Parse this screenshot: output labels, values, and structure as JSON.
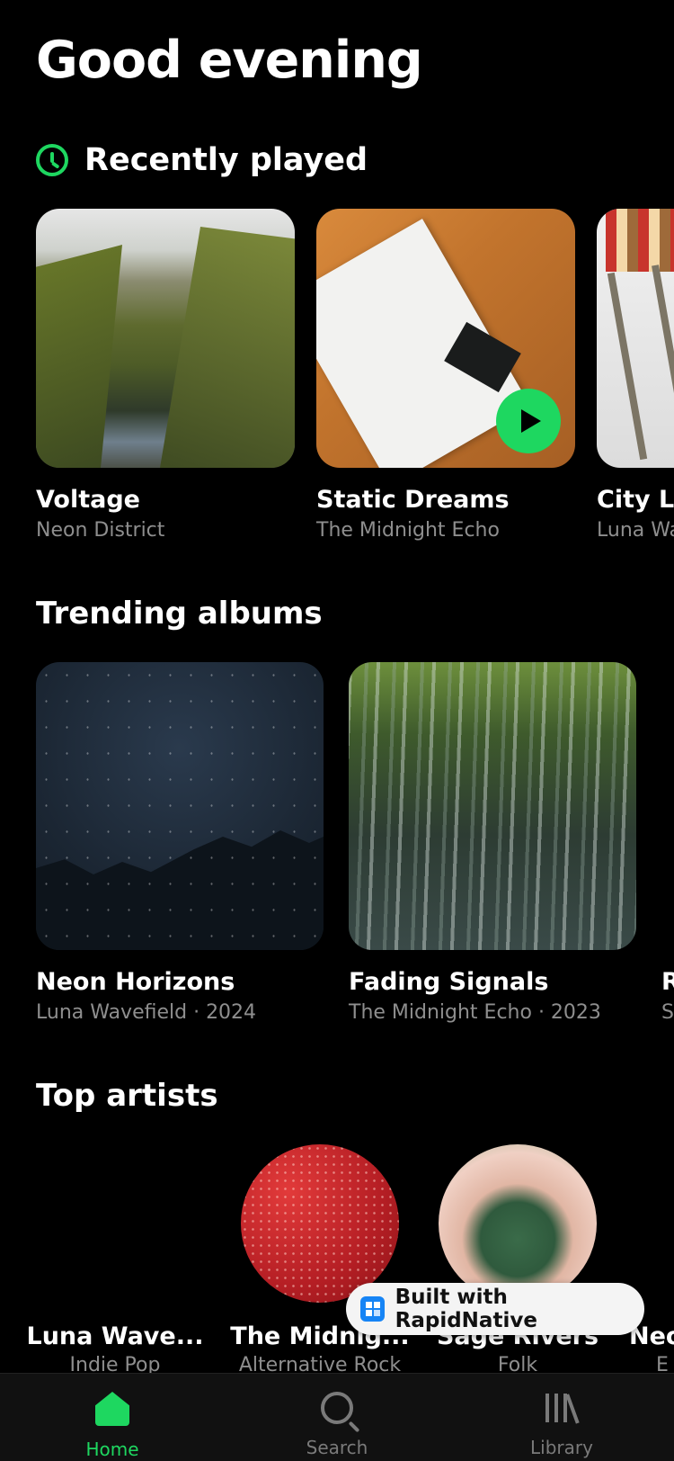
{
  "greeting": "Good evening",
  "recently_played": {
    "title": "Recently played",
    "items": [
      {
        "title": "Voltage",
        "artist": "Neon District"
      },
      {
        "title": "Static Dreams",
        "artist": "The Midnight Echo"
      },
      {
        "title": "City Li",
        "artist": "Luna Wa"
      }
    ]
  },
  "trending": {
    "title": "Trending albums",
    "items": [
      {
        "title": "Neon Horizons",
        "meta": "Luna Wavefield · 2024"
      },
      {
        "title": "Fading Signals",
        "meta": "The Midnight Echo · 2023"
      },
      {
        "title": "R",
        "meta": "S"
      }
    ]
  },
  "top_artists": {
    "title": "Top artists",
    "items": [
      {
        "name": "Luna Wave...",
        "genre": "Indie Pop"
      },
      {
        "name": "The Midnig...",
        "genre": "Alternative Rock"
      },
      {
        "name": "Sage Rivers",
        "genre": "Folk"
      },
      {
        "name": "Neo",
        "genre": "E"
      }
    ]
  },
  "badge": {
    "label": "Built with RapidNative"
  },
  "tabs": [
    {
      "label": "Home",
      "icon": "home-icon"
    },
    {
      "label": "Search",
      "icon": "search-icon"
    },
    {
      "label": "Library",
      "icon": "library-icon"
    }
  ],
  "colors": {
    "accent": "#1ed760",
    "background": "#000000",
    "muted": "#8e8e8e"
  }
}
